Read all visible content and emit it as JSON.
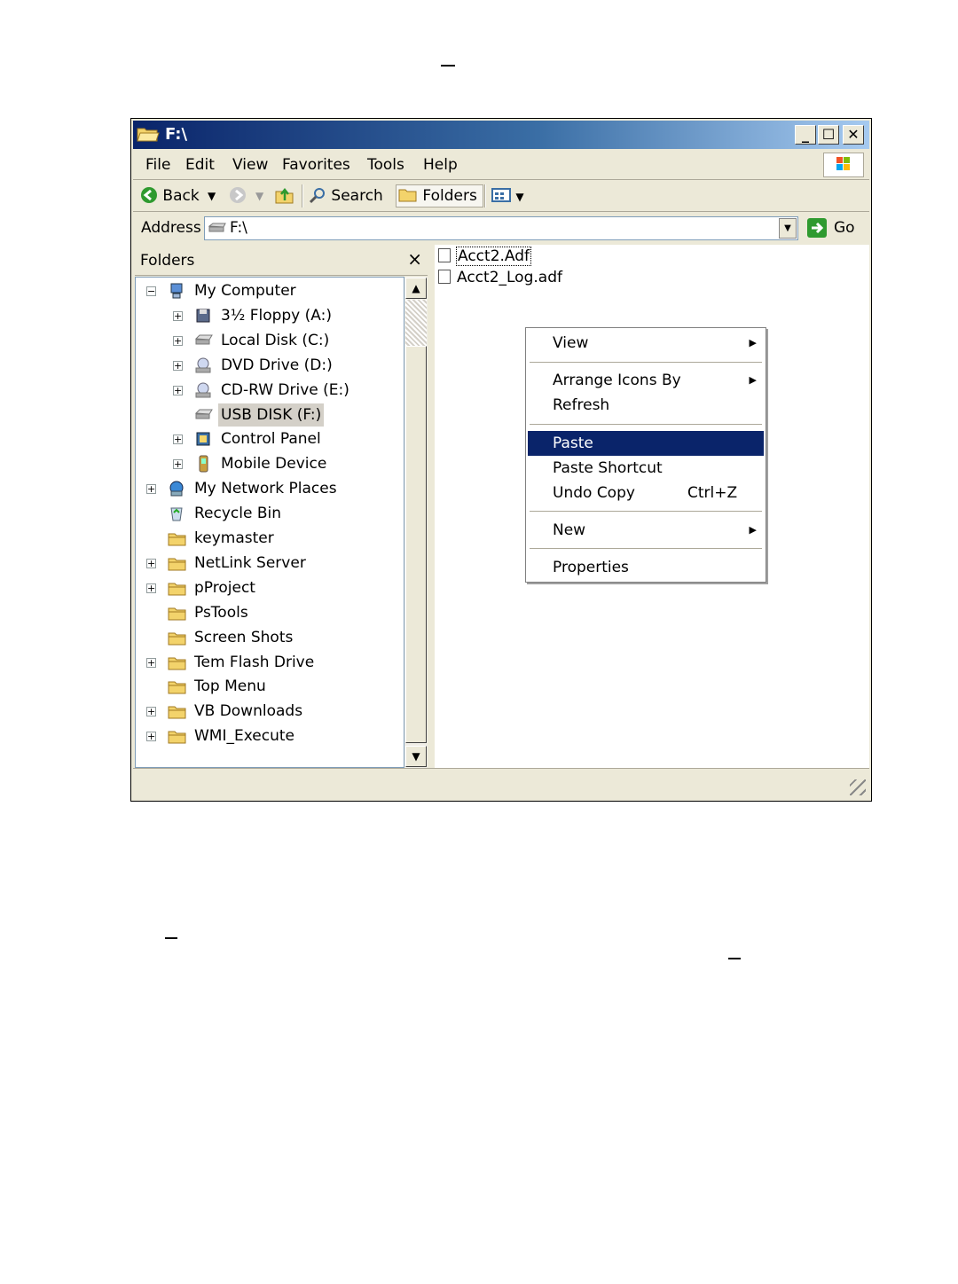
{
  "window": {
    "title": "F:\\"
  },
  "menubar": {
    "items": [
      "File",
      "Edit",
      "View",
      "Favorites",
      "Tools",
      "Help"
    ]
  },
  "toolbar": {
    "back_label": "Back",
    "search_label": "Search",
    "folders_label": "Folders"
  },
  "address": {
    "label": "Address",
    "value": "F:\\",
    "go_label": "Go"
  },
  "folders_pane": {
    "title": "Folders",
    "tree": [
      {
        "label": "My Computer",
        "level": 0,
        "expander": "−",
        "icon": "computer-icon"
      },
      {
        "label": "3½ Floppy (A:)",
        "level": 1,
        "expander": "+",
        "icon": "floppy-icon"
      },
      {
        "label": "Local Disk (C:)",
        "level": 1,
        "expander": "+",
        "icon": "hard-disk-icon"
      },
      {
        "label": "DVD Drive (D:)",
        "level": 1,
        "expander": "+",
        "icon": "dvd-drive-icon"
      },
      {
        "label": "CD-RW Drive (E:)",
        "level": 1,
        "expander": "+",
        "icon": "cd-drive-icon"
      },
      {
        "label": "USB DISK (F:)",
        "level": 1,
        "expander": "",
        "icon": "usb-disk-icon",
        "selected": true
      },
      {
        "label": "Control Panel",
        "level": 1,
        "expander": "+",
        "icon": "control-panel-icon"
      },
      {
        "label": "Mobile Device",
        "level": 1,
        "expander": "+",
        "icon": "mobile-device-icon"
      },
      {
        "label": "My Network Places",
        "level": 0,
        "expander": "+",
        "icon": "network-icon"
      },
      {
        "label": "Recycle Bin",
        "level": 0,
        "expander": "",
        "icon": "recycle-bin-icon"
      },
      {
        "label": "keymaster",
        "level": 0,
        "expander": "",
        "icon": "folder-icon"
      },
      {
        "label": "NetLink Server",
        "level": 0,
        "expander": "+",
        "icon": "folder-icon"
      },
      {
        "label": "pProject",
        "level": 0,
        "expander": "+",
        "icon": "folder-icon"
      },
      {
        "label": "PsTools",
        "level": 0,
        "expander": "",
        "icon": "folder-icon"
      },
      {
        "label": "Screen Shots",
        "level": 0,
        "expander": "",
        "icon": "folder-icon"
      },
      {
        "label": "Tem Flash Drive",
        "level": 0,
        "expander": "+",
        "icon": "folder-icon"
      },
      {
        "label": "Top Menu",
        "level": 0,
        "expander": "",
        "icon": "folder-icon"
      },
      {
        "label": "VB Downloads",
        "level": 0,
        "expander": "+",
        "icon": "folder-icon"
      },
      {
        "label": "WMI_Execute",
        "level": 0,
        "expander": "+",
        "icon": "folder-icon"
      }
    ]
  },
  "files": [
    "Acct2.Adf",
    "Acct2_Log.adf"
  ],
  "context_menu": {
    "items": [
      {
        "label": "View",
        "submenu": true
      },
      {
        "label": "Arrange Icons By",
        "submenu": true
      },
      {
        "label": "Refresh"
      },
      {
        "label": "Paste",
        "highlighted": true
      },
      {
        "label": "Paste Shortcut"
      },
      {
        "label": "Undo Copy",
        "shortcut": "Ctrl+Z"
      },
      {
        "label": "New",
        "submenu": true
      },
      {
        "label": "Properties"
      }
    ]
  },
  "colors": {
    "title_start": "#0a246a",
    "title_end": "#a6caf0",
    "highlight": "#0a246a",
    "chrome": "#ece9d8"
  }
}
